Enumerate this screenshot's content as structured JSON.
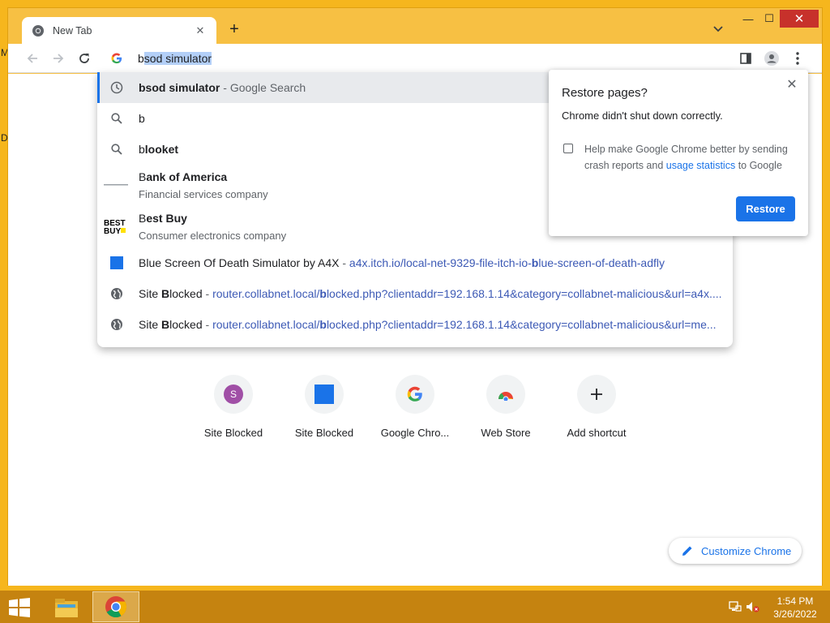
{
  "desktop": {
    "letters": [
      "M",
      "D"
    ]
  },
  "window": {
    "tab_title": "New Tab",
    "controls": {
      "minimize": "—",
      "maximize": "☐",
      "close": "✕"
    }
  },
  "omnibox": {
    "typed": "b",
    "autocompleted": "sod simulator"
  },
  "suggestions": [
    {
      "icon": "history-icon",
      "bold": "bsod simulator",
      "rest": "",
      "dash": " - ",
      "meta": "Google Search",
      "selected": true
    },
    {
      "icon": "search-icon",
      "plain": "b",
      "bold": ""
    },
    {
      "icon": "search-icon",
      "plain": "b",
      "bold": "looket"
    },
    {
      "icon": "bank-of-america-logo",
      "plain": "B",
      "bold": "ank of America",
      "sub": "Financial services company"
    },
    {
      "icon": "best-buy-logo",
      "plain": "B",
      "bold": "est Buy",
      "sub": "Consumer electronics company"
    },
    {
      "icon": "blue-square-icon",
      "plain": "B",
      "bold": "lue Screen Of Death Simulator by A4X",
      "dash": " - ",
      "url_pre": "a4x.itch.io/local-net-9329-file-itch-io-",
      "url_bold": "b",
      "url_post": "lue-screen-of-death-adfly"
    },
    {
      "icon": "globe-icon",
      "text_pre": "Site ",
      "text_bold": "B",
      "text_post": "locked",
      "dash": " - ",
      "url_pre": "router.collabnet.local/",
      "url_bold": "b",
      "url_post": "locked.php?clientaddr=192.168.1.14&category=collabnet-malicious&url=a4x...."
    },
    {
      "icon": "globe-icon",
      "text_pre": "Site ",
      "text_bold": "B",
      "text_post": "locked",
      "dash": " - ",
      "url_pre": "router.collabnet.local/",
      "url_bold": "b",
      "url_post": "locked.php?clientaddr=192.168.1.14&category=collabnet-malicious&url=me..."
    }
  ],
  "restore_bubble": {
    "title": "Restore pages?",
    "message": "Chrome didn't shut down correctly.",
    "checkbox_pre": "Help make Google Chrome better by sending crash reports and ",
    "checkbox_link": "usage statistics",
    "checkbox_post": " to Google",
    "button": "Restore",
    "checked": false
  },
  "shortcuts": [
    {
      "label": "Site Blocked",
      "icon": "letter-s-avatar",
      "letter": "S"
    },
    {
      "label": "Site Blocked",
      "icon": "blue-square-icon"
    },
    {
      "label": "Google Chro...",
      "icon": "google-g-icon"
    },
    {
      "label": "Web Store",
      "icon": "web-store-icon"
    },
    {
      "label": "Add shortcut",
      "icon": "plus-icon"
    }
  ],
  "customize": {
    "label": "Customize Chrome"
  },
  "taskbar": {
    "time": "1:54 PM",
    "date": "3/26/2022"
  },
  "colors": {
    "accent": "#1a73e8",
    "desktop": "#f6b61d",
    "taskbar": "#c58310",
    "url": "#3c59b5"
  }
}
